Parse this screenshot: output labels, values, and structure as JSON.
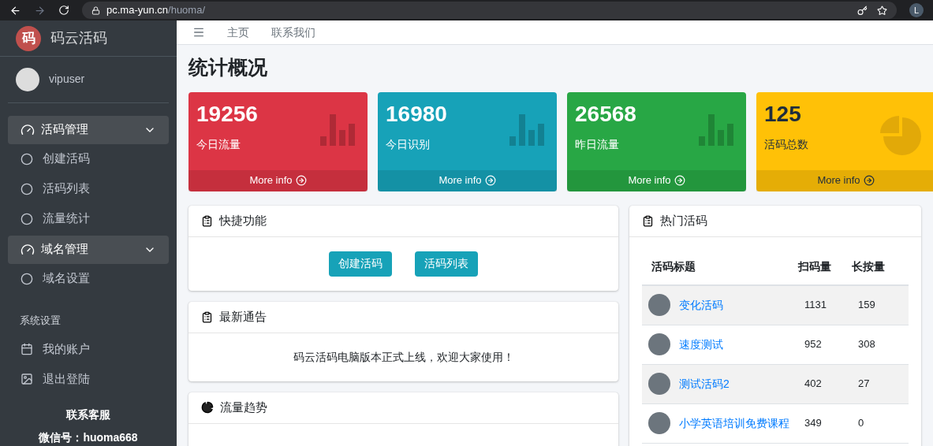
{
  "browser": {
    "url_host": "pc.ma-yun.cn",
    "url_path": "/huoma/",
    "profile": "L"
  },
  "sidebar": {
    "brand": {
      "logo": "码",
      "name": "码云活码"
    },
    "user": "vipuser",
    "items": [
      {
        "kind": "group",
        "label": "活码管理",
        "expanded": true
      },
      {
        "kind": "sub",
        "label": "创建活码"
      },
      {
        "kind": "sub",
        "label": "活码列表"
      },
      {
        "kind": "sub",
        "label": "流量统计"
      },
      {
        "kind": "group",
        "label": "域名管理",
        "expanded": true
      },
      {
        "kind": "sub",
        "label": "域名设置"
      },
      {
        "kind": "header",
        "label": "系统设置"
      },
      {
        "kind": "link",
        "label": "我的账户"
      },
      {
        "kind": "link",
        "label": "退出登陆"
      }
    ],
    "contact": {
      "title": "联系客服",
      "line": "微信号：huoma668"
    }
  },
  "topnav": [
    "主页",
    "联系我们"
  ],
  "page_title": "统计概况",
  "stats": [
    {
      "value": "19256",
      "label": "今日流量",
      "color": "#dc3545",
      "more": "More info"
    },
    {
      "value": "16980",
      "label": "今日识别",
      "color": "#17a2b8",
      "more": "More info"
    },
    {
      "value": "26568",
      "label": "昨日流量",
      "color": "#28a745",
      "more": "More info"
    },
    {
      "value": "125",
      "label": "活码总数",
      "color": "#ffc107",
      "more": "More info"
    }
  ],
  "quick": {
    "title": "快捷功能",
    "buttons": [
      "创建活码",
      "活码列表"
    ]
  },
  "notice": {
    "title": "最新通告",
    "text": "码云活码电脑版本正式上线，欢迎大家使用！"
  },
  "trend": {
    "title": "流量趋势"
  },
  "hot": {
    "title": "热门活码",
    "columns": [
      "活码标题",
      "扫码量",
      "长按量"
    ],
    "rows": [
      {
        "title": "变化活码",
        "scans": "1131",
        "presses": "159"
      },
      {
        "title": "速度测试",
        "scans": "952",
        "presses": "308"
      },
      {
        "title": "测试活码2",
        "scans": "402",
        "presses": "27"
      },
      {
        "title": "小学英语培训免费课程",
        "scans": "349",
        "presses": "0"
      }
    ]
  }
}
